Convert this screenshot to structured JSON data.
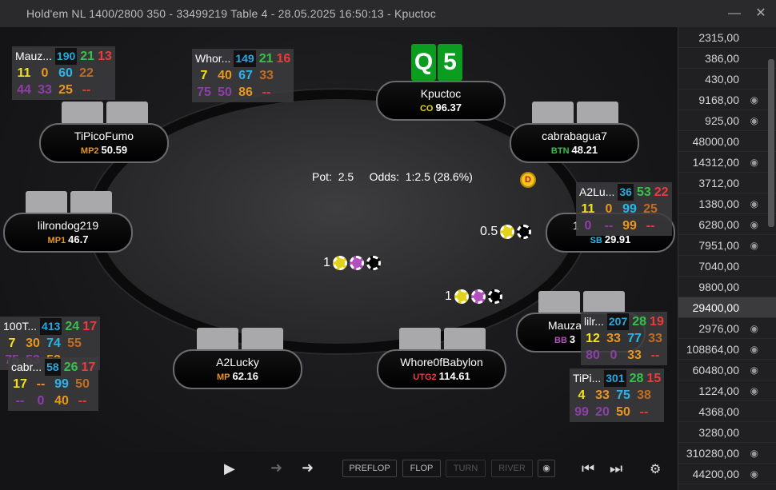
{
  "window": {
    "title": "Hold'em NL 1400/2800 350 - 33499219 Table 4 - 28.05.2025 16:50:13 - Kpuctoc"
  },
  "hero": {
    "name": "Kpuctoc",
    "pos": "CO",
    "stack": "96.37",
    "cards": [
      "Q",
      "5"
    ]
  },
  "table": {
    "pot_label": "Pot:",
    "pot": "2.5",
    "odds_label": "Odds:",
    "odds": "1:2.5 (28.6%)",
    "dealer": "D"
  },
  "seats": [
    {
      "name": "TiPicoFumo",
      "pos": "MP2",
      "stack": "50.59",
      "pos_color": "#e8961d"
    },
    {
      "name": "cabrabagua7",
      "pos": "BTN",
      "stack": "48.21",
      "pos_color": "#36c24a"
    },
    {
      "name": "lilrondog219",
      "pos": "MP1",
      "stack": "46.7",
      "pos_color": "#e8961d"
    },
    {
      "name": "1",
      "pos": "SB",
      "stack": "29.91",
      "pos_color": "#29b5e8"
    },
    {
      "name": "Mauza",
      "pos": "BB",
      "stack": "3",
      "pos_color": "#b24fbf"
    },
    {
      "name": "A2Lucky",
      "pos": "MP",
      "stack": "62.16",
      "pos_color": "#e8961d"
    },
    {
      "name": "Whore0fBabylon",
      "pos": "UTG2",
      "stack": "114.61",
      "pos_color": "#ee3a3a"
    }
  ],
  "bets": {
    "sb": "0.5",
    "left": "1",
    "bb": "1"
  },
  "huds": [
    {
      "name": "Mauz...",
      "a": "190",
      "b": "21",
      "c": "13",
      "d": "11",
      "e": "0",
      "f": "60",
      "g": "22",
      "h": "44",
      "i": "33",
      "j": "25",
      "k": "--"
    },
    {
      "name": "Whor...",
      "a": "149",
      "b": "21",
      "c": "16",
      "d": "7",
      "e": "40",
      "f": "67",
      "g": "33",
      "h": "75",
      "i": "50",
      "j": "86",
      "k": "--"
    },
    {
      "name": "A2Lu...",
      "a": "36",
      "b": "53",
      "c": "22",
      "d": "11",
      "e": "0",
      "f": "99",
      "g": "25",
      "h": "0",
      "i": "--",
      "j": "99",
      "k": "--"
    },
    {
      "name": "100T...",
      "a": "413",
      "b": "24",
      "c": "17",
      "d": "7",
      "e": "30",
      "f": "74",
      "g": "55",
      "h": "75",
      "i": "53",
      "j": "52",
      "k": ""
    },
    {
      "name": "cabr...",
      "a": "58",
      "b": "26",
      "c": "17",
      "d": "17",
      "e": "--",
      "f": "99",
      "g": "50",
      "h": "--",
      "i": "0",
      "j": "40",
      "k": "--"
    },
    {
      "name": "lilr...",
      "a": "207",
      "b": "28",
      "c": "19",
      "d": "12",
      "e": "33",
      "f": "77",
      "g": "33",
      "h": "80",
      "i": "0",
      "j": "33",
      "k": "--"
    },
    {
      "name": "TiPi...",
      "a": "301",
      "b": "28",
      "c": "15",
      "d": "4",
      "e": "33",
      "f": "75",
      "g": "38",
      "h": "99",
      "i": "20",
      "j": "50",
      "k": "--"
    }
  ],
  "controls": {
    "preflop": "PREFLOP",
    "flop": "FLOP",
    "turn": "TURN",
    "river": "RIVER"
  },
  "sidebar": [
    {
      "v": "2315,00",
      "eye": false
    },
    {
      "v": "386,00",
      "eye": false
    },
    {
      "v": "430,00",
      "eye": false
    },
    {
      "v": "9168,00",
      "eye": true
    },
    {
      "v": "925,00",
      "eye": true
    },
    {
      "v": "48000,00",
      "eye": false
    },
    {
      "v": "14312,00",
      "eye": true
    },
    {
      "v": "3712,00",
      "eye": false
    },
    {
      "v": "1380,00",
      "eye": true
    },
    {
      "v": "6280,00",
      "eye": true
    },
    {
      "v": "7951,00",
      "eye": true
    },
    {
      "v": "7040,00",
      "eye": false
    },
    {
      "v": "9800,00",
      "eye": false
    },
    {
      "v": "29400,00",
      "eye": false,
      "sel": true
    },
    {
      "v": "2976,00",
      "eye": true
    },
    {
      "v": "108864,00",
      "eye": true
    },
    {
      "v": "60480,00",
      "eye": true
    },
    {
      "v": "1224,00",
      "eye": true
    },
    {
      "v": "4368,00",
      "eye": false
    },
    {
      "v": "3280,00",
      "eye": false
    },
    {
      "v": "310280,00",
      "eye": true
    },
    {
      "v": "44200,00",
      "eye": true
    }
  ]
}
